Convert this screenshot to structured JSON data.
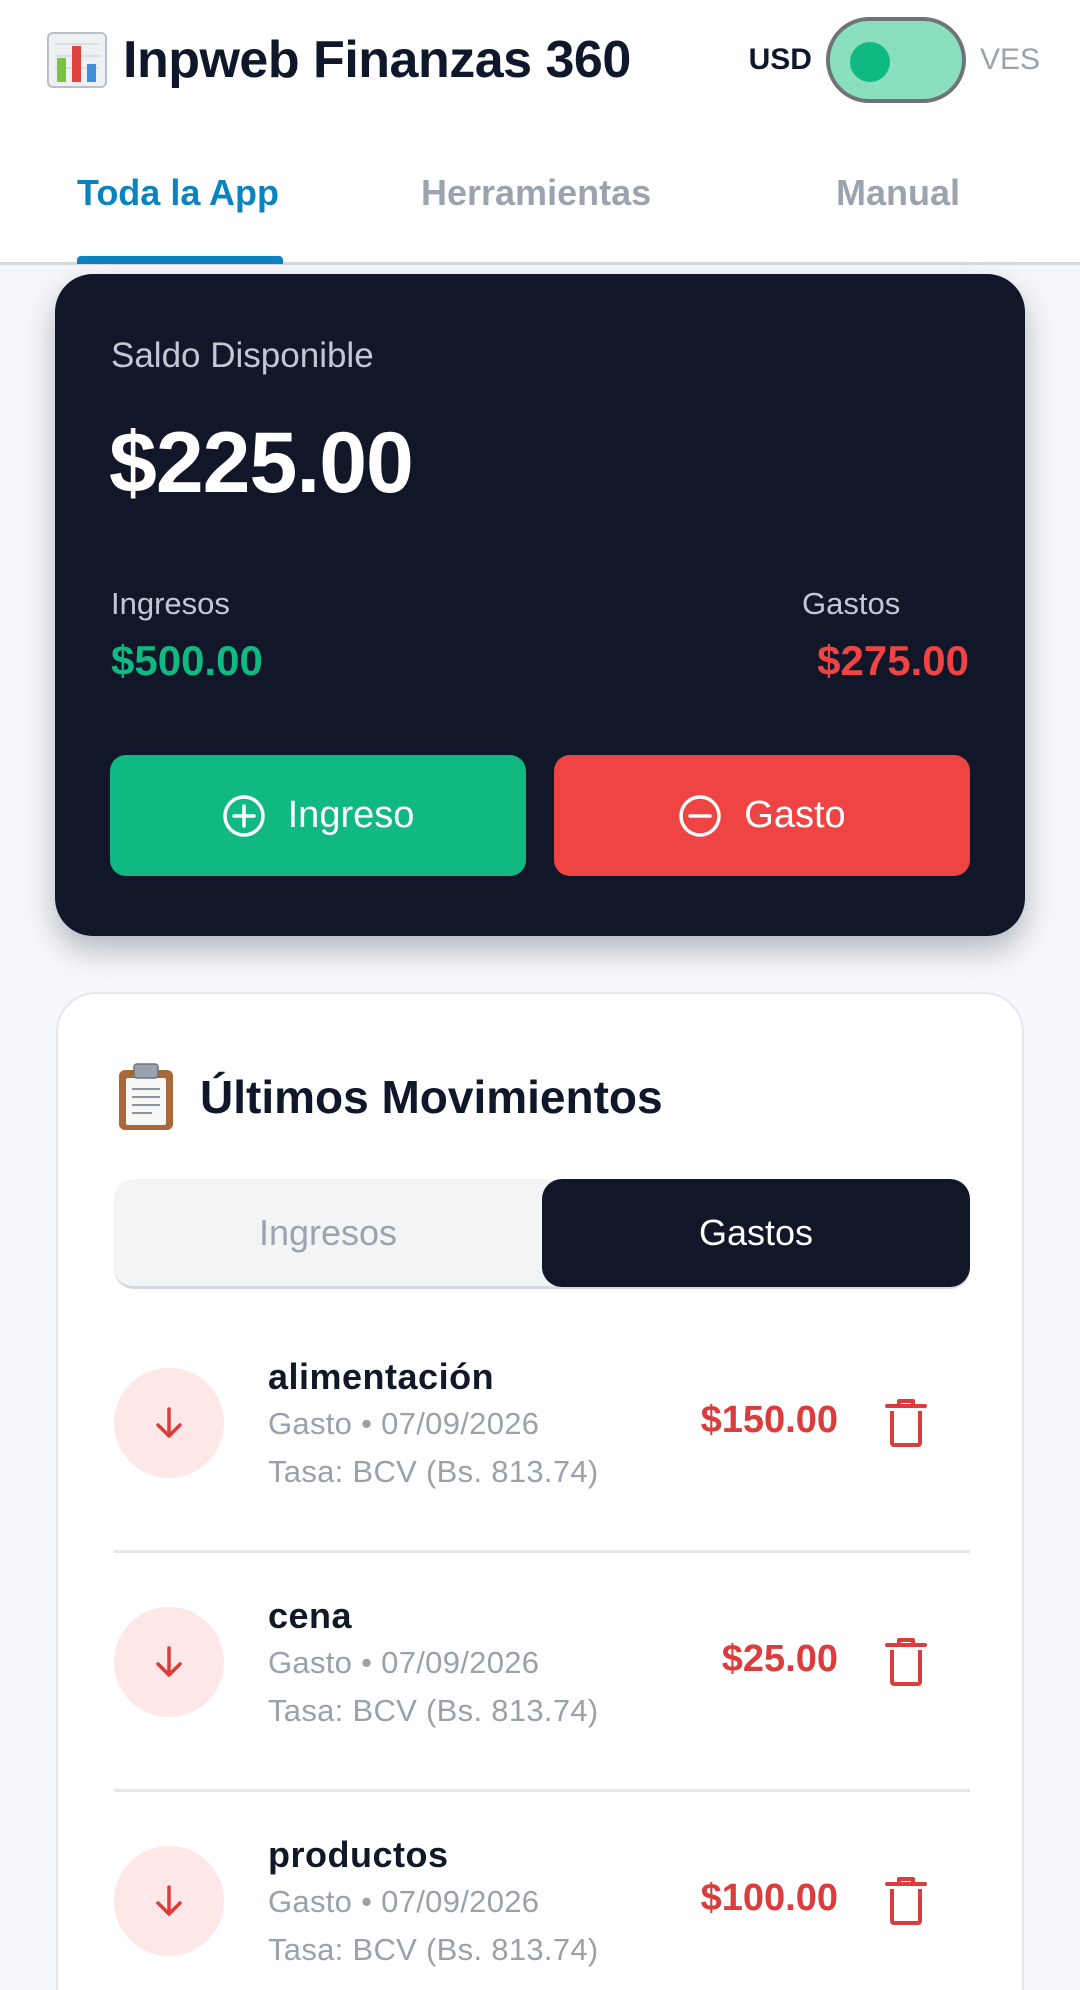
{
  "header": {
    "app_title": "Inpweb Finanzas 360",
    "logo_icon": "bar-chart-icon",
    "currency": {
      "left": "USD",
      "right": "VES",
      "selected": "USD"
    }
  },
  "tabs": [
    {
      "label": "Toda la App",
      "active": true
    },
    {
      "label": "Herramientas",
      "active": false
    },
    {
      "label": "Manual",
      "active": false
    }
  ],
  "balance": {
    "label": "Saldo Disponible",
    "amount": "$225.00",
    "income_label": "Ingresos",
    "income_value": "$500.00",
    "expense_label": "Gastos",
    "expense_value": "$275.00",
    "income_button": "Ingreso",
    "expense_button": "Gasto"
  },
  "movements": {
    "title": "Últimos Movimientos",
    "title_icon": "clipboard-icon",
    "segments": [
      {
        "label": "Ingresos",
        "active": false
      },
      {
        "label": "Gastos",
        "active": true
      }
    ],
    "items": [
      {
        "name": "alimentación",
        "meta": "Gasto • 07/09/2026",
        "rate": "Tasa: BCV (Bs. 813.74)",
        "amount": "$150.00"
      },
      {
        "name": "cena",
        "meta": "Gasto • 07/09/2026",
        "rate": "Tasa: BCV (Bs. 813.74)",
        "amount": "$25.00"
      },
      {
        "name": "productos",
        "meta": "Gasto • 07/09/2026",
        "rate": "Tasa: BCV (Bs. 813.74)",
        "amount": "$100.00"
      }
    ]
  },
  "colors": {
    "accent": "#0a84c1",
    "card_dark": "#111729",
    "income": "#10b981",
    "expense": "#ef4444"
  }
}
